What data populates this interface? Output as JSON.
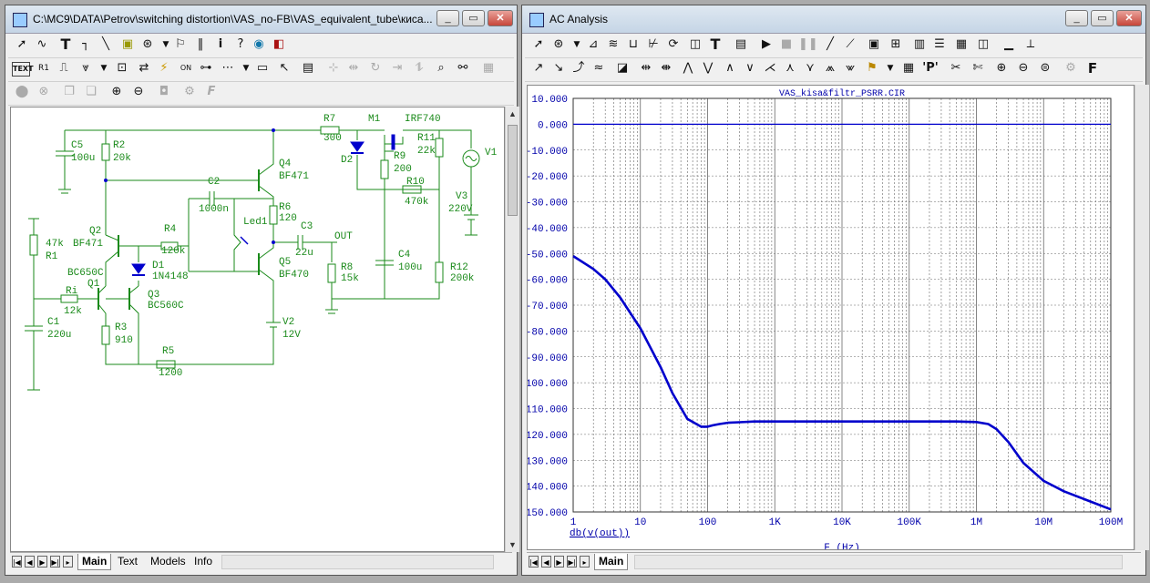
{
  "schematic_window": {
    "title": "C:\\MC9\\DATA\\Petrov\\switching distortion\\VAS_no-FB\\VAS_equivalent_tube\\киса...",
    "controls": {
      "minimize": "_",
      "maximize": "▭",
      "close": "✕"
    },
    "tabs": [
      "Main",
      "Text",
      "Models",
      "Info"
    ],
    "labels": [
      {
        "id": "C5",
        "text": "C5"
      },
      {
        "id": "C5v",
        "text": "100u"
      },
      {
        "id": "R2",
        "text": "R2"
      },
      {
        "id": "R2v",
        "text": "20k"
      },
      {
        "id": "R7",
        "text": "R7"
      },
      {
        "id": "R7v",
        "text": "300"
      },
      {
        "id": "M1",
        "text": "M1"
      },
      {
        "id": "M1m",
        "text": "IRF740"
      },
      {
        "id": "Q4",
        "text": "Q4"
      },
      {
        "id": "Q4m",
        "text": "BF471"
      },
      {
        "id": "D2",
        "text": "D2"
      },
      {
        "id": "R11",
        "text": "R11"
      },
      {
        "id": "R11v",
        "text": "22k"
      },
      {
        "id": "V1",
        "text": "V1"
      },
      {
        "id": "R9",
        "text": "R9"
      },
      {
        "id": "R9v",
        "text": "200"
      },
      {
        "id": "C2",
        "text": "C2"
      },
      {
        "id": "C2v",
        "text": "1000n"
      },
      {
        "id": "R10",
        "text": "R10"
      },
      {
        "id": "R10v",
        "text": "470k"
      },
      {
        "id": "V3",
        "text": "V3"
      },
      {
        "id": "V3v",
        "text": "220V"
      },
      {
        "id": "R6",
        "text": "R6"
      },
      {
        "id": "R6v",
        "text": "120"
      },
      {
        "id": "Led1",
        "text": "Led1"
      },
      {
        "id": "C3",
        "text": "C3"
      },
      {
        "id": "C3v",
        "text": "22u"
      },
      {
        "id": "OUT",
        "text": "OUT"
      },
      {
        "id": "Q2",
        "text": "Q2"
      },
      {
        "id": "Q2m",
        "text": "BF471"
      },
      {
        "id": "R4",
        "text": "R4"
      },
      {
        "id": "R4v",
        "text": "120k"
      },
      {
        "id": "R1v",
        "text": "47k"
      },
      {
        "id": "R1",
        "text": "R1"
      },
      {
        "id": "D1",
        "text": "D1"
      },
      {
        "id": "D1m",
        "text": "1N4148"
      },
      {
        "id": "C4",
        "text": "C4"
      },
      {
        "id": "C4v",
        "text": "100u"
      },
      {
        "id": "Q5",
        "text": "Q5"
      },
      {
        "id": "Q5m",
        "text": "BF470"
      },
      {
        "id": "R8",
        "text": "R8"
      },
      {
        "id": "R8v",
        "text": "15k"
      },
      {
        "id": "R12",
        "text": "R12"
      },
      {
        "id": "R12v",
        "text": "200k"
      },
      {
        "id": "BC650C",
        "text": "BC650C"
      },
      {
        "id": "Q1",
        "text": "Q1"
      },
      {
        "id": "Q3",
        "text": "Q3"
      },
      {
        "id": "Q3m",
        "text": "BC560C"
      },
      {
        "id": "Ri",
        "text": "Ri"
      },
      {
        "id": "Riv",
        "text": "12k"
      },
      {
        "id": "C1",
        "text": "C1"
      },
      {
        "id": "C1v",
        "text": "220u"
      },
      {
        "id": "R3",
        "text": "R3"
      },
      {
        "id": "R3v",
        "text": "910"
      },
      {
        "id": "V2",
        "text": "V2"
      },
      {
        "id": "V2v",
        "text": "12V"
      },
      {
        "id": "R5",
        "text": "R5"
      },
      {
        "id": "R5v",
        "text": "1200"
      }
    ]
  },
  "analysis_window": {
    "title": "AC Analysis",
    "controls": {
      "minimize": "_",
      "maximize": "▭",
      "close": "✕"
    },
    "tabs": [
      "Main"
    ],
    "chart_data": {
      "type": "line",
      "title": "VAS_kisa&filtr_PSRR.CIR",
      "xlabel": "F (Hz)",
      "ylabel": "db(v(out))",
      "xscale": "log",
      "xlim": [
        1,
        100000000
      ],
      "ylim": [
        -150,
        10
      ],
      "grid": true,
      "xticks": [
        "1",
        "10",
        "100",
        "1K",
        "10K",
        "100K",
        "1M",
        "10M",
        "100M"
      ],
      "yticks": [
        "10.000",
        "0.000",
        "-10.000",
        "-20.000",
        "-30.000",
        "-40.000",
        "-50.000",
        "-60.000",
        "-70.000",
        "-80.000",
        "-90.000",
        "-100.000",
        "-110.000",
        "-120.000",
        "-130.000",
        "-140.000",
        "-150.000"
      ],
      "series": [
        {
          "color": "#0000cc",
          "x": [
            1,
            2,
            3,
            5,
            10,
            20,
            30,
            50,
            80,
            100,
            120,
            150,
            200,
            300,
            500,
            1000,
            10000,
            100000,
            500000,
            1000000,
            1500000,
            2000000,
            3000000,
            5000000,
            10000000,
            20000000,
            50000000,
            100000000
          ],
          "y": [
            -51,
            -56,
            -60,
            -67,
            -79,
            -94,
            -104,
            -114,
            -117,
            -117,
            -116.5,
            -116,
            -115.5,
            -115.3,
            -115,
            -115,
            -115,
            -115,
            -115,
            -115.2,
            -116,
            -118,
            -123,
            -131,
            -138,
            -142,
            -146,
            -149
          ]
        },
        {
          "color": "#0000cc",
          "x": [
            1,
            100000000
          ],
          "y": [
            0,
            0
          ]
        }
      ]
    }
  }
}
